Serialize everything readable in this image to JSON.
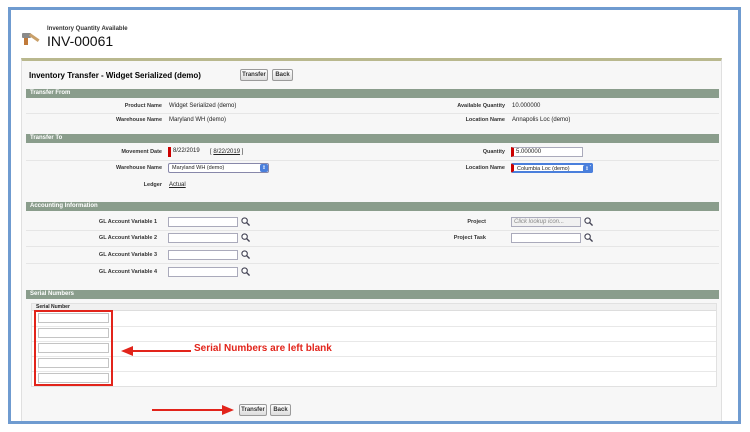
{
  "header": {
    "subtitle": "Inventory Quantity Available",
    "title": "INV-00061"
  },
  "panel": {
    "title": "Inventory Transfer - Widget Serialized (demo)",
    "transfer_label": "Transfer",
    "back_label": "Back"
  },
  "transfer_from": {
    "section_title": "Transfer From",
    "product_name_label": "Product Name",
    "product_name_value": "Widget Serialized (demo)",
    "available_qty_label": "Available Quantity",
    "available_qty_value": "10.000000",
    "warehouse_label": "Warehouse Name",
    "warehouse_value": "Maryland WH (demo)",
    "location_label": "Location Name",
    "location_value": "Annapolis Loc (demo)"
  },
  "transfer_to": {
    "section_title": "Transfer To",
    "movement_date_label": "Movement Date",
    "movement_date_value": "8/22/2019",
    "movement_date_link": "8/22/2019",
    "quantity_label": "Quantity",
    "quantity_value": "5.000000",
    "warehouse_label": "Warehouse Name",
    "warehouse_value": "Maryland WH (demo)",
    "location_label": "Location Name",
    "location_value": "Columbia Loc (demo)",
    "ledger_label": "Ledger",
    "ledger_value": "Actual"
  },
  "accounting": {
    "section_title": "Accounting Information",
    "gl1_label": "GL Account Variable 1",
    "gl2_label": "GL Account Variable 2",
    "gl3_label": "GL Account Variable 3",
    "gl4_label": "GL Account Variable 4",
    "project_label": "Project",
    "project_placeholder": "Click lookup icon...",
    "project_task_label": "Project Task"
  },
  "serial_numbers": {
    "section_title": "Serial Numbers",
    "column_header": "Serial Number",
    "annotation": "Serial Numbers are left blank"
  },
  "colors": {
    "annotation_red": "#e2241b",
    "section_header": "#8a9d8c",
    "frame_blue": "#6f9bd0"
  }
}
